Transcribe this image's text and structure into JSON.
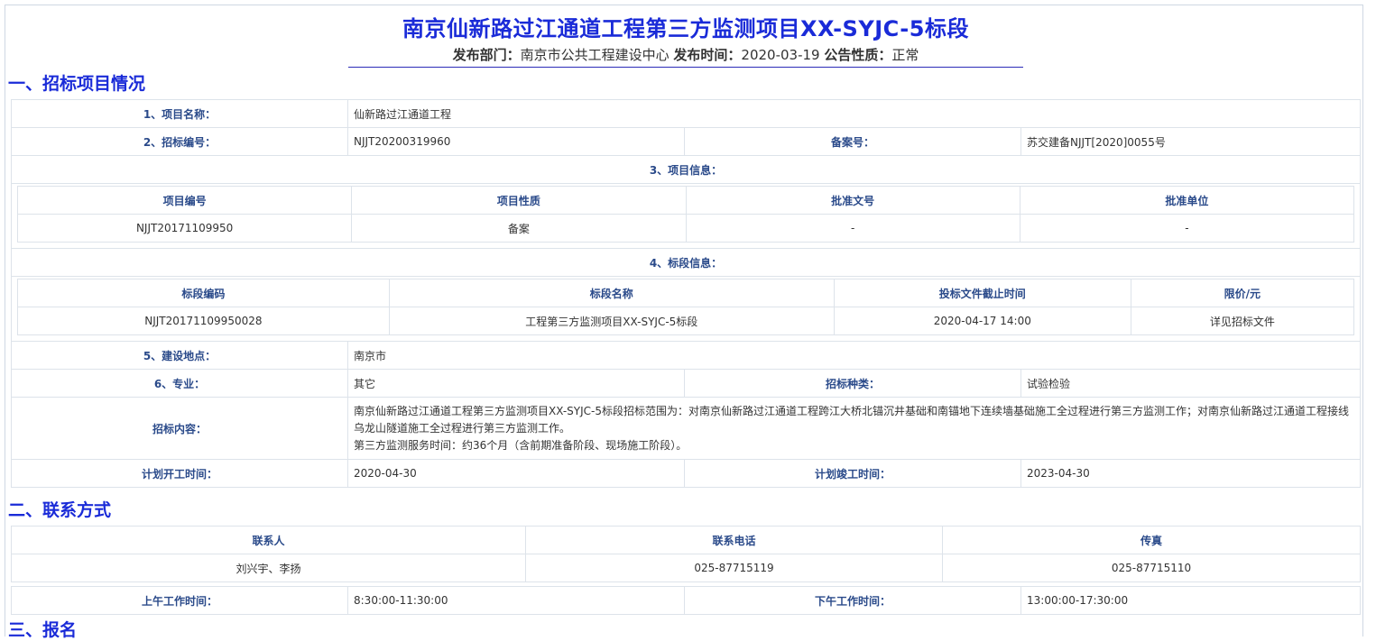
{
  "title": "南京仙新路过江通道工程第三方监测项目XX-SYJC-5标段",
  "meta": {
    "dept_label": "发布部门：",
    "dept_value": "南京市公共工程建设中心",
    "time_label": "发布时间：",
    "time_value": "2020-03-19",
    "nature_label": "公告性质：",
    "nature_value": "正常"
  },
  "section1": {
    "heading": "一、招标项目情况",
    "project_name_label": "1、项目名称：",
    "project_name": "仙新路过江通道工程",
    "bid_no_label": "2、招标编号：",
    "bid_no": "NJJT20200319960",
    "record_no_label": "备案号：",
    "record_no": "苏交建备NJJT[2020]0055号",
    "project_info_label": "3、项目信息：",
    "project_info": {
      "headers": [
        "项目编号",
        "项目性质",
        "批准文号",
        "批准单位"
      ],
      "row": [
        "NJJT20171109950",
        "备案",
        "-",
        "-"
      ]
    },
    "section_info_label": "4、标段信息：",
    "section_info": {
      "headers": [
        "标段编码",
        "标段名称",
        "投标文件截止时间",
        "限价/元"
      ],
      "row": [
        "NJJT20171109950028",
        "工程第三方监测项目XX-SYJC-5标段",
        "2020-04-17 14:00",
        "详见招标文件"
      ]
    },
    "location_label": "5、建设地点：",
    "location": "南京市",
    "specialty_label": "6、专业：",
    "specialty": "其它",
    "bid_type_label": "招标种类：",
    "bid_type": "试验检验",
    "content_label": "招标内容：",
    "content_line1": "南京仙新路过江通道工程第三方监测项目XX-SYJC-5标段招标范围为：对南京仙新路过江通道工程跨江大桥北锚沉井基础和南锚地下连续墙基础施工全过程进行第三方监测工作；对南京仙新路过江通道工程接线",
    "content_line2": "乌龙山隧道施工全过程进行第三方监测工作。",
    "content_line3": "第三方监测服务时间：约36个月（含前期准备阶段、现场施工阶段）。",
    "start_label": "计划开工时间：",
    "start": "2020-04-30",
    "end_label": "计划竣工时间：",
    "end": "2023-04-30"
  },
  "section2": {
    "heading": "二、联系方式",
    "headers": [
      "联系人",
      "联系电话",
      "传真"
    ],
    "row": [
      "刘兴宇、李扬",
      "025-87715119",
      "025-87715110"
    ],
    "am_label": "上午工作时间：",
    "am": "8:30:00-11:30:00",
    "pm_label": "下午工作时间：",
    "pm": "13:00:00-17:30:00"
  },
  "section3": {
    "heading": "三、报名"
  }
}
